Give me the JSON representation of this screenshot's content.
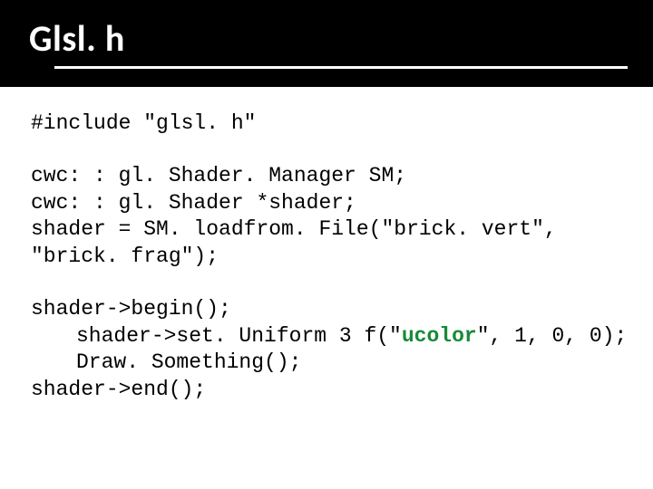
{
  "title": "Glsl. h",
  "code": {
    "l1": "#include \"glsl. h\"",
    "l2": "cwc: : gl. Shader. Manager SM;",
    "l3": "cwc: : gl. Shader *shader;",
    "l4": "shader = SM. loadfrom. File(\"brick. vert\",",
    "l5": "\"brick. frag\");",
    "l6": "shader->begin();",
    "l7a": "shader->set. Uniform 3 f(\"",
    "l7hl": "ucolor",
    "l7b": "\", 1, 0, 0);",
    "l8": "Draw. Something();",
    "l9": "shader->end();"
  }
}
